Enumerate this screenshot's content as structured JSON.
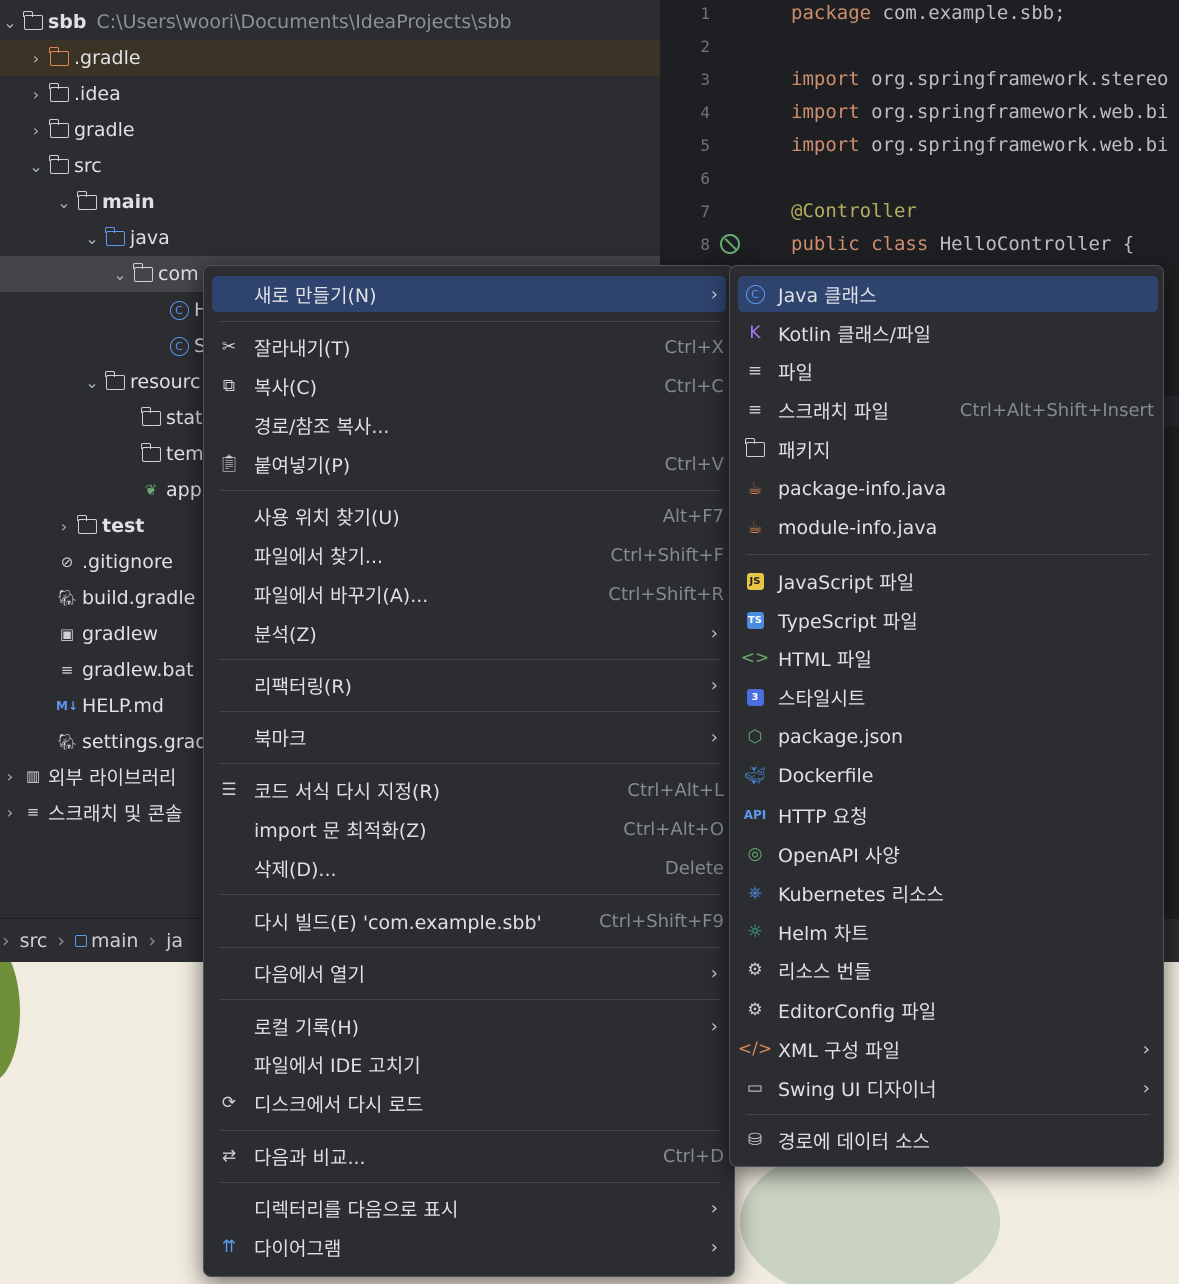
{
  "project": {
    "root_name": "sbb",
    "root_path": "C:\\Users\\woori\\Documents\\IdeaProjects\\sbb",
    "items": [
      {
        "label": ".gradle"
      },
      {
        "label": ".idea"
      },
      {
        "label": "gradle"
      },
      {
        "label": "src"
      },
      {
        "label": "main"
      },
      {
        "label": "java"
      },
      {
        "label": "com"
      },
      {
        "label": "H"
      },
      {
        "label": "S"
      },
      {
        "label": "resourc"
      },
      {
        "label": "stat"
      },
      {
        "label": "tem"
      },
      {
        "label": "app"
      },
      {
        "label": "test"
      },
      {
        "label": ".gitignore"
      },
      {
        "label": "build.gradle"
      },
      {
        "label": "gradlew"
      },
      {
        "label": "gradlew.bat"
      },
      {
        "label": "HELP.md"
      },
      {
        "label": "settings.grad"
      },
      {
        "label": "외부 라이브러리"
      },
      {
        "label": "스크래치 및 콘솔"
      }
    ]
  },
  "editor": {
    "line_numbers": [
      "1",
      "2",
      "3",
      "4",
      "5",
      "6",
      "7",
      "8"
    ],
    "lines": {
      "l1_kw": "package",
      "l1_rest": " com.example.sbb;",
      "l3_kw": "import",
      "l3_rest": " org.springframework.stereo",
      "l4_kw": "import",
      "l4_rest": " org.springframework.web.bi",
      "l5_kw": "import",
      "l5_rest": " org.springframework.web.bi",
      "l7_ann": "@Controller",
      "l8_kw1": "public",
      "l8_kw2": "class",
      "l8_rest": " HelloController {"
    }
  },
  "breadcrumb": [
    "src",
    "main",
    "ja"
  ],
  "context_menu": {
    "items": [
      {
        "label": "새로 만들기(N)",
        "shortcut": "",
        "icon": "none"
      },
      {
        "label": "잘라내기(T)",
        "shortcut": "Ctrl+X",
        "icon": "scissors-icon"
      },
      {
        "label": "복사(C)",
        "shortcut": "Ctrl+C",
        "icon": "copy-icon"
      },
      {
        "label": "경로/참조 복사...",
        "shortcut": "",
        "icon": "none"
      },
      {
        "label": "붙여넣기(P)",
        "shortcut": "Ctrl+V",
        "icon": "paste-icon"
      },
      {
        "label": "사용 위치 찾기(U)",
        "shortcut": "Alt+F7",
        "icon": "none"
      },
      {
        "label": "파일에서 찾기...",
        "shortcut": "Ctrl+Shift+F",
        "icon": "none"
      },
      {
        "label": "파일에서 바꾸기(A)...",
        "shortcut": "Ctrl+Shift+R",
        "icon": "none"
      },
      {
        "label": "분석(Z)",
        "shortcut": "",
        "icon": "none"
      },
      {
        "label": "리팩터링(R)",
        "shortcut": "",
        "icon": "none"
      },
      {
        "label": "북마크",
        "shortcut": "",
        "icon": "none"
      },
      {
        "label": "코드 서식 다시 지정(R)",
        "shortcut": "Ctrl+Alt+L",
        "icon": "reformat-icon"
      },
      {
        "label": "import 문 최적화(Z)",
        "shortcut": "Ctrl+Alt+O",
        "icon": "none"
      },
      {
        "label": "삭제(D)...",
        "shortcut": "Delete",
        "icon": "none"
      },
      {
        "label": "다시 빌드(E) 'com.example.sbb'",
        "shortcut": "Ctrl+Shift+F9",
        "icon": "none"
      },
      {
        "label": "다음에서 열기",
        "shortcut": "",
        "icon": "none"
      },
      {
        "label": "로컬 기록(H)",
        "shortcut": "",
        "icon": "none"
      },
      {
        "label": "파일에서 IDE 고치기",
        "shortcut": "",
        "icon": "none"
      },
      {
        "label": "디스크에서 다시 로드",
        "shortcut": "",
        "icon": "reload-icon"
      },
      {
        "label": "다음과 비교...",
        "shortcut": "Ctrl+D",
        "icon": "compare-icon"
      },
      {
        "label": "디렉터리를 다음으로 표시",
        "shortcut": "",
        "icon": "none"
      },
      {
        "label": "다이어그램",
        "shortcut": "",
        "icon": "diagram-icon"
      }
    ]
  },
  "submenu": {
    "items": [
      {
        "label": "Java 클래스",
        "shortcut": ""
      },
      {
        "label": "Kotlin 클래스/파일",
        "shortcut": ""
      },
      {
        "label": "파일",
        "shortcut": ""
      },
      {
        "label": "스크래치 파일",
        "shortcut": "Ctrl+Alt+Shift+Insert"
      },
      {
        "label": "패키지",
        "shortcut": ""
      },
      {
        "label": "package-info.java",
        "shortcut": ""
      },
      {
        "label": "module-info.java",
        "shortcut": ""
      },
      {
        "label": "JavaScript 파일",
        "shortcut": ""
      },
      {
        "label": "TypeScript 파일",
        "shortcut": ""
      },
      {
        "label": "HTML 파일",
        "shortcut": ""
      },
      {
        "label": "스타일시트",
        "shortcut": ""
      },
      {
        "label": "package.json",
        "shortcut": ""
      },
      {
        "label": "Dockerfile",
        "shortcut": ""
      },
      {
        "label": "HTTP 요청",
        "shortcut": ""
      },
      {
        "label": "OpenAPI 사양",
        "shortcut": ""
      },
      {
        "label": "Kubernetes 리소스",
        "shortcut": ""
      },
      {
        "label": "Helm 차트",
        "shortcut": ""
      },
      {
        "label": "리소스 번들",
        "shortcut": ""
      },
      {
        "label": "EditorConfig 파일",
        "shortcut": ""
      },
      {
        "label": "XML 구성 파일",
        "shortcut": ""
      },
      {
        "label": "Swing UI 디자이너",
        "shortcut": ""
      },
      {
        "label": "경로에 데이터 소스",
        "shortcut": ""
      }
    ],
    "badges": {
      "js": "JS",
      "ts": "TS",
      "api": "API",
      "css": "3"
    }
  },
  "colors": {
    "accent": "#2e436e",
    "menu_bg": "#2b2d30",
    "editor_bg": "#1e1f22",
    "keyword": "#cf8e6d",
    "annotation": "#b3ae60"
  }
}
